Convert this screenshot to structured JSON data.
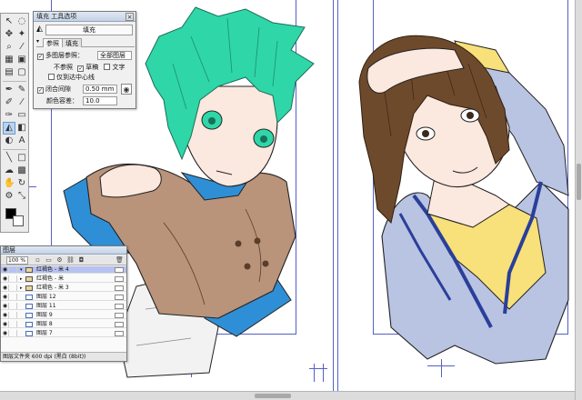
{
  "tool_options": {
    "title": "填充 工具选项",
    "close": "×",
    "tool_name": "填充",
    "tabs": [
      "参照",
      "填充"
    ],
    "multi_layer_label": "多图层参照：",
    "multi_layer_value": "全部图层",
    "no_ref_label": "不参照",
    "draft_label": "草稿",
    "text_label": "文字",
    "ref_guide_label": "仅到达中心线",
    "close_gap_label": "闭合间隙",
    "close_gap_value": "0.50 mm",
    "tolerance_label": "颜色容差：",
    "tolerance_value": "10.0"
  },
  "layers": {
    "title": "图层",
    "zoom": "100 %",
    "status": "图层文件夹 600 dpi (黑白 (8bit))",
    "rows": [
      {
        "name": "红褐色 - 米 4",
        "selected": true,
        "folder": true
      },
      {
        "name": "红褐色 - 米",
        "selected": false,
        "folder": true
      },
      {
        "name": "红褐色 - 米 3",
        "selected": false,
        "folder": true
      },
      {
        "name": "图层 12",
        "selected": false,
        "folder": false
      },
      {
        "name": "图层 11",
        "selected": false,
        "folder": false
      },
      {
        "name": "图层 9",
        "selected": false,
        "folder": false
      },
      {
        "name": "图层 8",
        "selected": false,
        "folder": false
      },
      {
        "name": "图层 7",
        "selected": false,
        "folder": false
      }
    ]
  },
  "colors": {
    "teal_hair": "#2fd6a8",
    "brown_hair": "#6e4a2c",
    "coat": "#b9937a",
    "scarf": "#2f8fd6",
    "skin": "#fbe8de",
    "yellow_shirt": "#f8e07a",
    "blue_jacket": "#b9c3e2",
    "jacket_trim": "#2a3f9a",
    "guide": "#5560c8",
    "selection": "#b7c2f0"
  }
}
